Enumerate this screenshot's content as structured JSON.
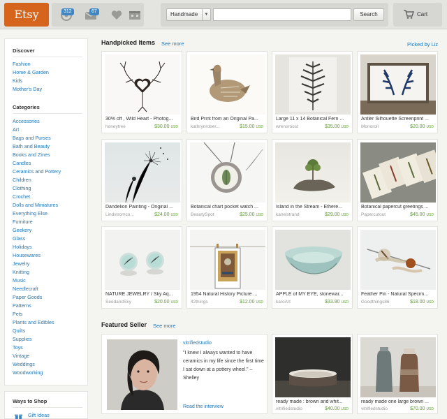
{
  "header": {
    "logo": "Etsy",
    "notifications_count": "312",
    "messages_count": "67",
    "search_category": "Handmade",
    "search_placeholder": "",
    "search_button": "Search",
    "cart_label": "Cart"
  },
  "sidebar": {
    "discover_heading": "Discover",
    "discover_items": [
      "Fashion",
      "Home & Garden",
      "Kids",
      "Mother's Day"
    ],
    "categories_heading": "Categories",
    "category_items": [
      "Accessories",
      "Art",
      "Bags and Purses",
      "Bath and Beauty",
      "Books and Zines",
      "Candles",
      "Ceramics and Pottery",
      "Children",
      "Clothing",
      "Crochet",
      "Dolls and Miniatures",
      "Everything Else",
      "Furniture",
      "Geekery",
      "Glass",
      "Holidays",
      "Housewares",
      "Jewelry",
      "Knitting",
      "Music",
      "Needlecraft",
      "Paper Goods",
      "Patterns",
      "Pets",
      "Plants and Edibles",
      "Quilts",
      "Supplies",
      "Toys",
      "Vintage",
      "Weddings",
      "Woodworking"
    ],
    "ways_heading": "Ways to Shop",
    "ways_items": [
      "Gift Ideas"
    ]
  },
  "handpicked": {
    "title": "Handpicked Items",
    "see_more": "See more",
    "picked_by": "Picked by Liz",
    "items": [
      {
        "title": "30% off , Wild Heart - Photog...",
        "shop": "honeytree",
        "price": "$30.00",
        "currency": "USD"
      },
      {
        "title": "Bird Print from an Original Pa...",
        "shop": "kathrynrober...",
        "price": "$15.00",
        "currency": "USD"
      },
      {
        "title": "Large 11 x 14 Botanical Fern ...",
        "shop": "wrensroost",
        "price": "$35.00",
        "currency": "USD"
      },
      {
        "title": "Antler Silhouette Screenprint ...",
        "shop": "Monoroll",
        "price": "$20.00",
        "currency": "USD"
      },
      {
        "title": "Dandelion Painting - Original ...",
        "shop": "Lindstromco...",
        "price": "$24.00",
        "currency": "USD"
      },
      {
        "title": "Botanical chart pocket watch ...",
        "shop": "BeautySpot",
        "price": "$25.00",
        "currency": "USD"
      },
      {
        "title": "Island in the Stream - Ethere...",
        "shop": "kanelstrand",
        "price": "$29.00",
        "currency": "USD"
      },
      {
        "title": "Botanical papercut greetings ...",
        "shop": "Papercutout",
        "price": "$45.00",
        "currency": "USD"
      },
      {
        "title": "NATURE JEWELRY / Sky Aq...",
        "shop": "SeedandSky",
        "price": "$20.00",
        "currency": "USD"
      },
      {
        "title": "1954 Natural History Picture ...",
        "shop": "42things",
        "price": "$12.00",
        "currency": "USD"
      },
      {
        "title": "APPLE of MY EYE, stonewar...",
        "shop": "karoArt",
        "price": "$33.90",
        "currency": "USD"
      },
      {
        "title": "Feather Pin - Natural Specim...",
        "shop": "Goodthings86",
        "price": "$18.00",
        "currency": "USD"
      }
    ]
  },
  "featured": {
    "title": "Featured Seller",
    "see_more": "See more",
    "seller_name": "vitrifiedstudio",
    "quote": "\"I knew I always wanted to have ceramics in my life since the first time I sat down at a pottery wheel.\" – Shelley",
    "interview_link": "Read the interview",
    "items": [
      {
        "title": "ready made : brown and whit...",
        "shop": "vitrifiedstudio",
        "price": "$40.00",
        "currency": "USD"
      },
      {
        "title": "ready made one large brown ...",
        "shop": "vitrifiedstudio",
        "price": "$70.00",
        "currency": "USD"
      }
    ]
  },
  "colors": {
    "brand": "#d5641c",
    "link": "#1f76b7",
    "price": "#5aa02c",
    "badge": "#3e86c4"
  }
}
